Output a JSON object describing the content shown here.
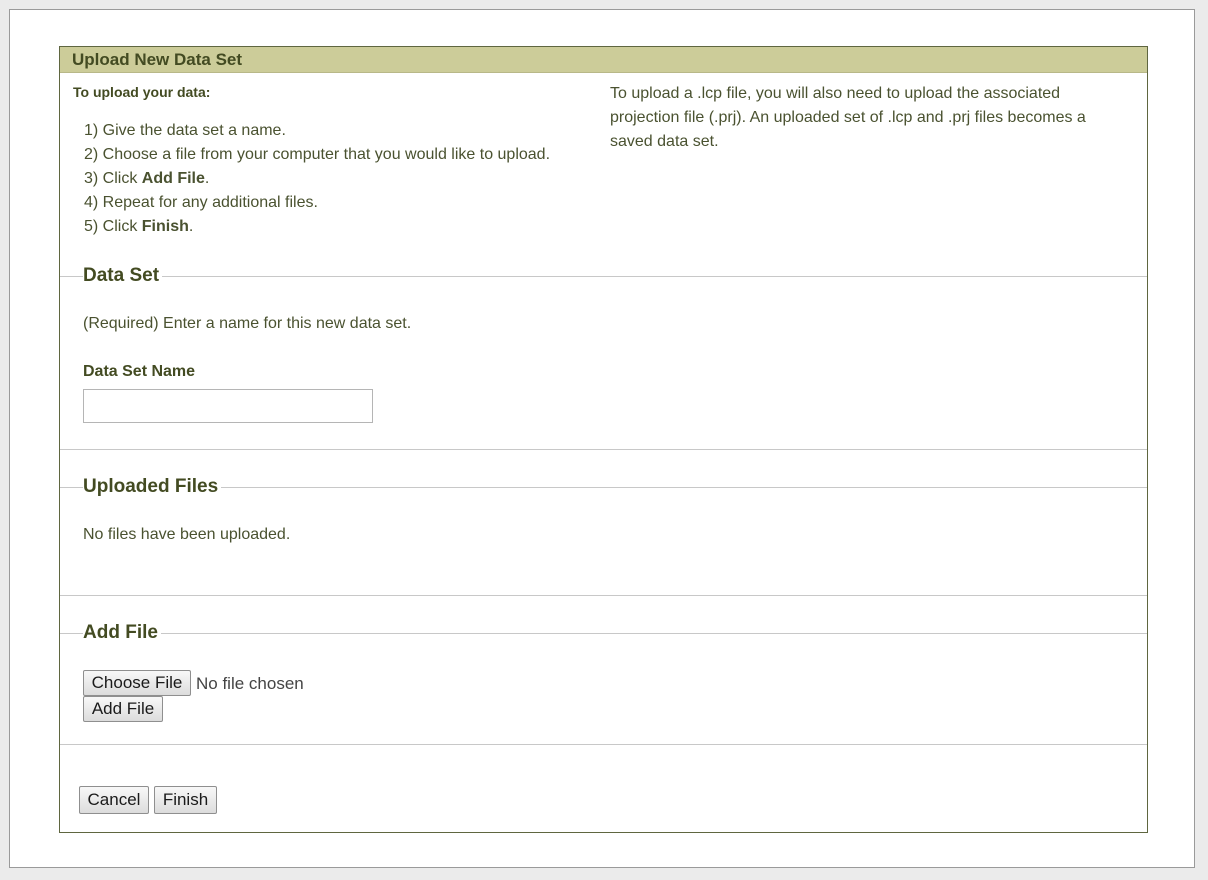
{
  "panel": {
    "title": "Upload New Data Set"
  },
  "intro": {
    "heading": "To upload your data:",
    "steps": [
      {
        "prefix": "1) Give the data set a name.",
        "bold": "",
        "suffix": ""
      },
      {
        "prefix": "2) Choose a file from your computer that you would like to upload.",
        "bold": "",
        "suffix": ""
      },
      {
        "prefix": "3) Click ",
        "bold": "Add File",
        "suffix": "."
      },
      {
        "prefix": "4) Repeat for any additional files.",
        "bold": "",
        "suffix": ""
      },
      {
        "prefix": "5) Click ",
        "bold": "Finish",
        "suffix": "."
      }
    ],
    "note": "To upload a .lcp file, you will also need to upload the associated projection file (.prj). An uploaded set of .lcp and .prj files becomes a saved data set."
  },
  "data_set": {
    "legend": "Data Set",
    "instruction": "(Required) Enter a name for this new data set.",
    "name_label": "Data Set Name",
    "name_value": ""
  },
  "uploaded_files": {
    "legend": "Uploaded Files",
    "empty_text": "No files have been uploaded."
  },
  "add_file": {
    "legend": "Add File",
    "choose_label": "Choose File",
    "file_status": "No file chosen",
    "add_label": "Add File"
  },
  "actions": {
    "cancel_label": "Cancel",
    "finish_label": "Finish"
  }
}
